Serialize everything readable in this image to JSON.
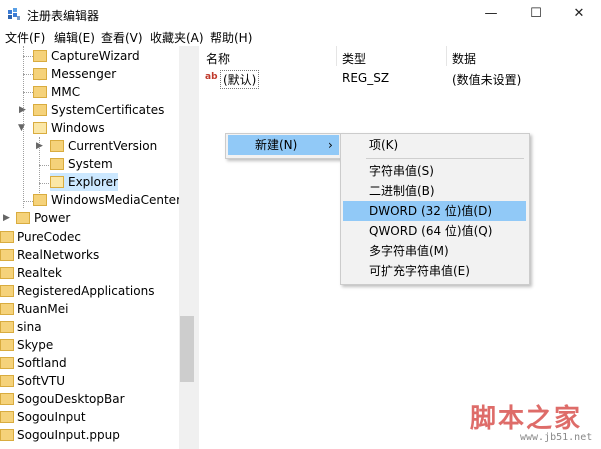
{
  "window": {
    "title": "注册表编辑器",
    "minimize_glyph": "—",
    "maximize_glyph": "☐",
    "close_glyph": "✕"
  },
  "menubar": [
    "文件(F)",
    "编辑(E)",
    "查看(V)",
    "收藏夹(A)",
    "帮助(H)"
  ],
  "tree": {
    "items": [
      "CaptureWizard",
      "Messenger",
      "MMC",
      "SystemCertificates",
      "Windows",
      "CurrentVersion",
      "System",
      "Explorer",
      "WindowsMediaCenter",
      "Power",
      "PureCodec",
      "RealNetworks",
      "Realtek",
      "RegisteredApplications",
      "RuanMei",
      "sina",
      "Skype",
      "Softland",
      "SoftVTU",
      "SogouDesktopBar",
      "SogouInput",
      "SogouInput.ppup"
    ]
  },
  "list": {
    "columns": [
      "名称",
      "类型",
      "数据"
    ],
    "rows": [
      {
        "name": "(默认)",
        "type": "REG_SZ",
        "data": "(数值未设置)",
        "icon": "ab"
      }
    ]
  },
  "context_menu": {
    "new_label": "新建(N)",
    "arrow": "›"
  },
  "submenu": [
    "项(K)",
    "字符串值(S)",
    "二进制值(B)",
    "DWORD (32 位)值(D)",
    "QWORD (64 位)值(Q)",
    "多字符串值(M)",
    "可扩充字符串值(E)"
  ],
  "watermark": {
    "main": "脚本之家",
    "url": "www.jb51.net"
  },
  "colors": {
    "selection": "#cce8ff",
    "menu_highlight": "#91c9f7",
    "folder": "#f5d27a"
  }
}
